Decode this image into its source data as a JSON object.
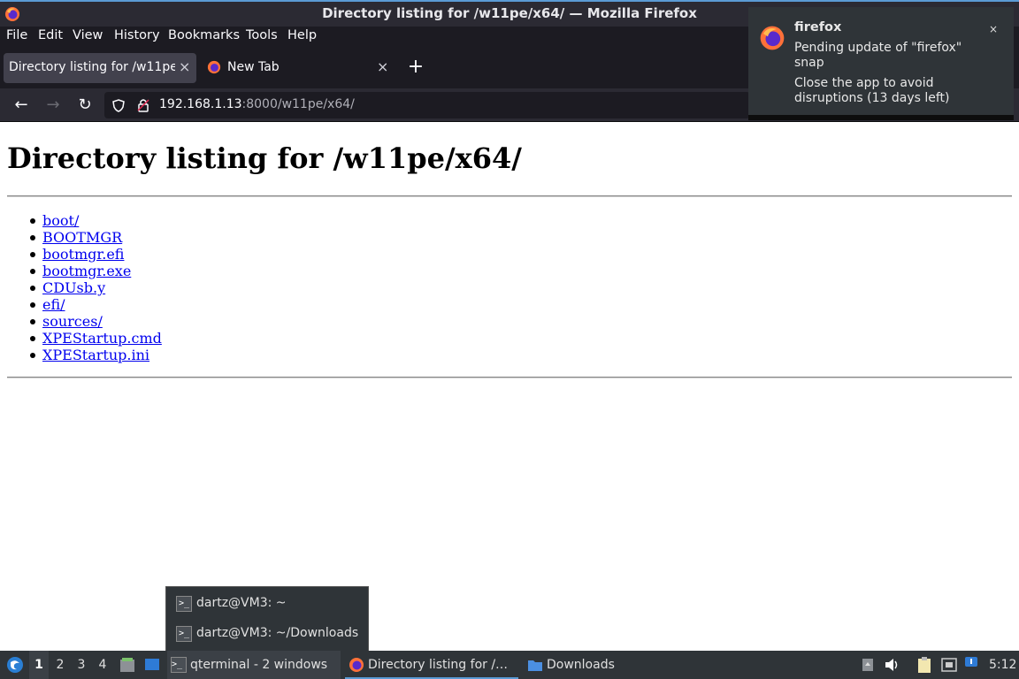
{
  "window": {
    "title": "Directory listing for /w11pe/x64/ — Mozilla Firefox"
  },
  "menu": [
    "File",
    "Edit",
    "View",
    "History",
    "Bookmarks",
    "Tools",
    "Help"
  ],
  "tabs": [
    {
      "label": "Directory listing for /w11pe/x64/"
    },
    {
      "label": "New Tab"
    }
  ],
  "url": {
    "host": "192.168.1.13",
    "rest": ":8000/w11pe/x64/"
  },
  "page": {
    "heading": "Directory listing for /w11pe/x64/",
    "files": [
      "boot/",
      "BOOTMGR",
      "bootmgr.efi",
      "bootmgr.exe",
      "CDUsb.y",
      "efi/",
      "sources/",
      "XPEStartup.cmd",
      "XPEStartup.ini"
    ]
  },
  "notification": {
    "app": "firefox",
    "line1": "Pending update of \"firefox\" snap",
    "line2": "Close the app to avoid disruptions (13 days left)",
    "close": "×"
  },
  "popup": {
    "items": [
      "dartz@VM3: ~",
      "dartz@VM3: ~/Downloads"
    ]
  },
  "taskbar": {
    "workspaces": [
      "1",
      "2",
      "3",
      "4"
    ],
    "tasks": [
      "qterminal - 2 windows",
      "Directory listing for /…",
      "Downloads"
    ],
    "clock": "5:12"
  },
  "colors": {
    "accent": "#5b9bd5",
    "link": "#0000ee",
    "chrome_dark": "#1c1b22"
  }
}
